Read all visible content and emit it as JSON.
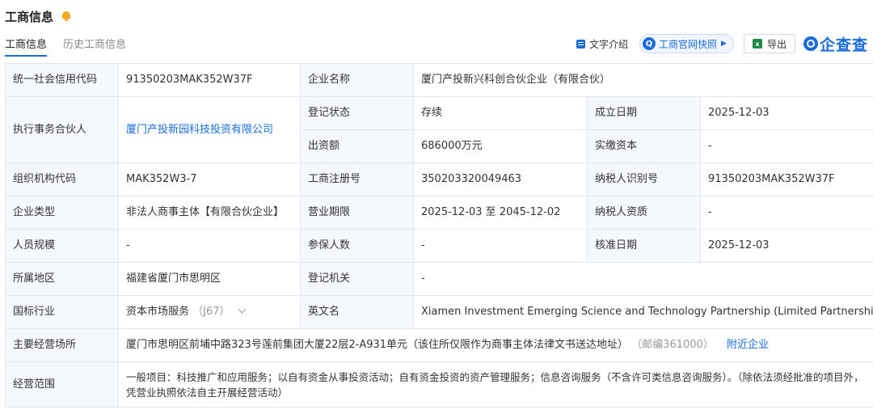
{
  "header": {
    "title": "工商信息"
  },
  "tabs": [
    {
      "label": "工商信息"
    },
    {
      "label": "历史工商信息"
    }
  ],
  "toolbar": {
    "text_intro": "文字介绍",
    "snapshot": "工商官网快照",
    "export": "导出",
    "logo": "企查查"
  },
  "colors": {
    "accent": "#1a6cd8",
    "label_bg": "#f5f8fc",
    "border": "#e4e8ee",
    "bell": "#f5a623"
  },
  "icons": [
    "bell-icon",
    "document-icon",
    "snapshot-icon",
    "play-triangle-icon",
    "excel-icon",
    "qichacha-logo-icon",
    "chevron-down-icon"
  ],
  "fields": {
    "credit_code": {
      "label": "统一社会信用代码",
      "value": "91350203MAK352W37F"
    },
    "company_name": {
      "label": "企业名称",
      "value": "厦门产投新兴科创合伙企业（有限合伙）"
    },
    "partner": {
      "label": "执行事务合伙人",
      "value": "厦门产投新园科技投资有限公司"
    },
    "reg_status": {
      "label": "登记状态",
      "value": "存续"
    },
    "founded": {
      "label": "成立日期",
      "value": "2025-12-03"
    },
    "capital": {
      "label": "出资额",
      "value": "686000万元"
    },
    "paid_capital": {
      "label": "实缴资本",
      "value": "-"
    },
    "org_code": {
      "label": "组织机构代码",
      "value": "MAK352W3-7"
    },
    "reg_no": {
      "label": "工商注册号",
      "value": "350203320049463"
    },
    "taxpayer_id": {
      "label": "纳税人识别号",
      "value": "91350203MAK352W37F"
    },
    "company_type": {
      "label": "企业类型",
      "value": "非法人商事主体【有限合伙企业】"
    },
    "term": {
      "label": "营业期限",
      "value": "2025-12-03 至 2045-12-02"
    },
    "taxpayer_qual": {
      "label": "纳税人资质",
      "value": "-"
    },
    "staff_size": {
      "label": "人员规模",
      "value": "-"
    },
    "insured": {
      "label": "参保人数",
      "value": "-"
    },
    "approval_date": {
      "label": "核准日期",
      "value": "2025-12-03"
    },
    "region": {
      "label": "所属地区",
      "value": "福建省厦门市思明区"
    },
    "reg_authority": {
      "label": "登记机关",
      "value": "-"
    },
    "industry": {
      "label": "国标行业",
      "value": "资本市场服务",
      "code": "（J67）"
    },
    "english_name": {
      "label": "英文名",
      "value": "Xiamen Investment Emerging Science and Technology Partnership (Limited Partnership)"
    },
    "address": {
      "label": "主要经营场所",
      "value": "厦门市思明区前埔中路323号莲前集团大厦22层2-A931单元（该住所仅限作为商事主体法律文书送达地址）",
      "postcode": "（邮编361000）",
      "nearby": "附近企业"
    },
    "scope": {
      "label": "经营范围",
      "value": "一般项目：科技推广和应用服务；以自有资金从事投资活动；自有资金投资的资产管理服务；信息咨询服务（不含许可类信息咨询服务）。（除依法须经批准的项目外，凭营业执照依法自主开展经营活动）"
    }
  }
}
